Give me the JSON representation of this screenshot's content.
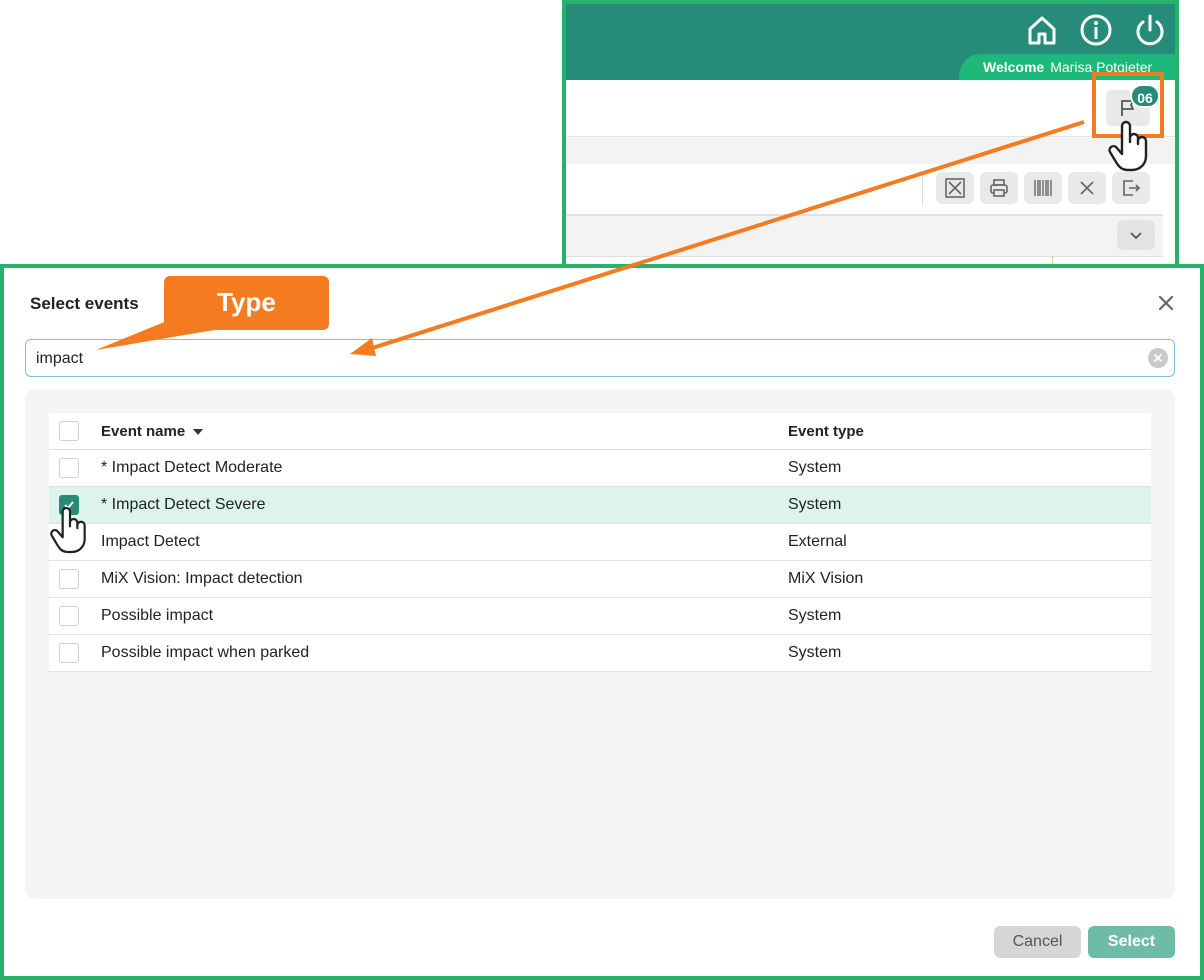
{
  "header": {
    "welcome_label": "Welcome",
    "user_name": "Marisa Potgieter",
    "notification_count": "06",
    "icons": [
      "home-icon",
      "info-icon",
      "power-icon",
      "flag-icon"
    ]
  },
  "toolbar": {
    "icons": [
      "expand-icon",
      "print-icon",
      "barcode-icon",
      "close-icon",
      "export-icon",
      "chevron-down-icon"
    ]
  },
  "annotation": {
    "callout_text": "Type",
    "accent_color": "#f47b1f"
  },
  "dialog": {
    "title": "Select events",
    "search_value": "impact",
    "columns": {
      "name": "Event name",
      "type": "Event type"
    },
    "rows": [
      {
        "name": "* Impact Detect Moderate",
        "type": "System",
        "checked": false
      },
      {
        "name": "* Impact Detect Severe",
        "type": "System",
        "checked": true
      },
      {
        "name": "Impact Detect",
        "type": "External",
        "checked": false
      },
      {
        "name": "MiX Vision: Impact detection",
        "type": "MiX Vision",
        "checked": false
      },
      {
        "name": "Possible impact",
        "type": "System",
        "checked": false
      },
      {
        "name": "Possible impact when parked",
        "type": "System",
        "checked": false
      }
    ],
    "cancel_label": "Cancel",
    "select_label": "Select"
  },
  "colors": {
    "brand": "#268b78",
    "frame": "#25b36b",
    "selected_row": "#dcf3ee"
  }
}
